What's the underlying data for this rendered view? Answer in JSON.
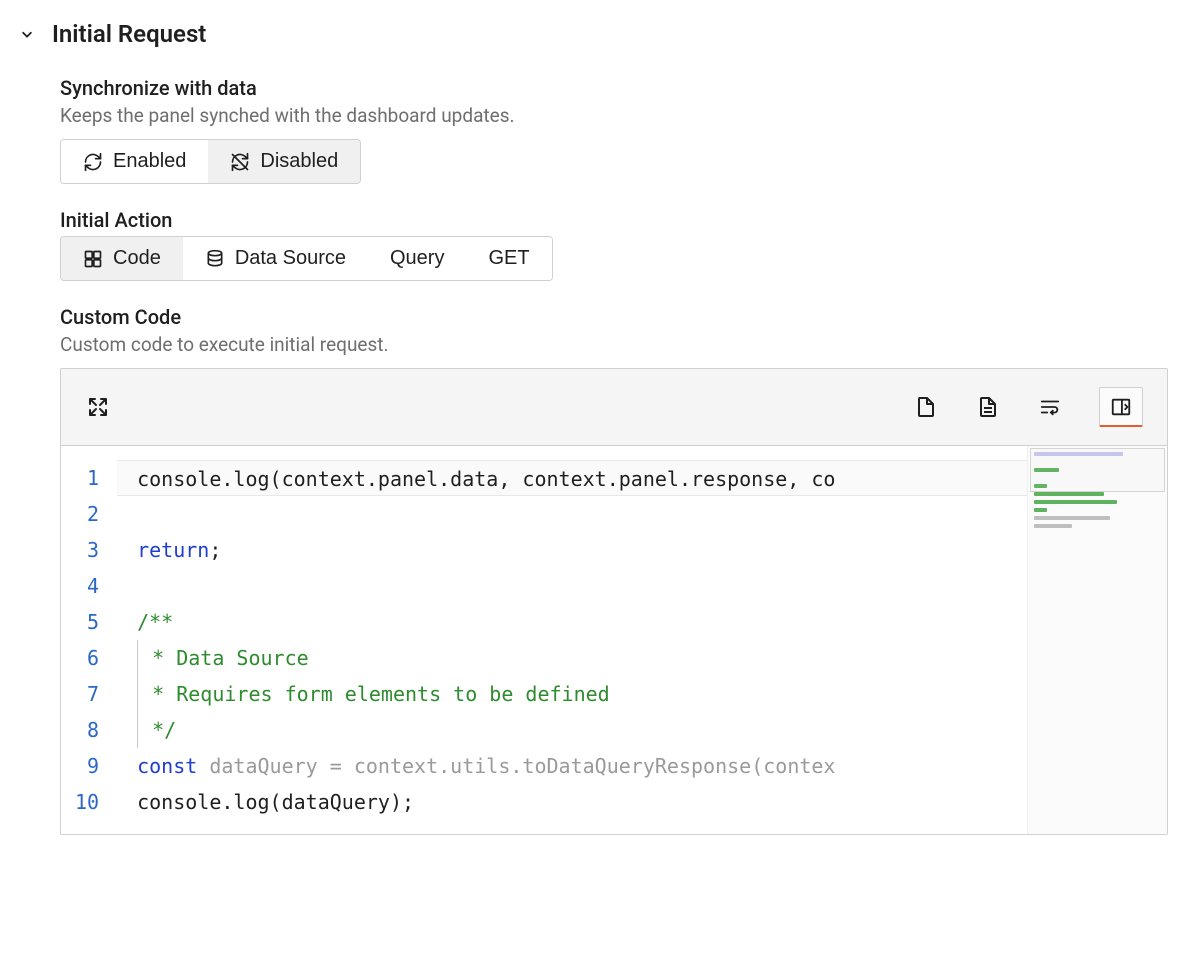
{
  "section": {
    "title": "Initial Request"
  },
  "sync": {
    "label": "Synchronize with data",
    "description": "Keeps the panel synched with the dashboard updates.",
    "options": {
      "enabled": "Enabled",
      "disabled": "Disabled"
    },
    "selected": "disabled"
  },
  "initialAction": {
    "label": "Initial Action",
    "options": {
      "code": "Code",
      "dataSource": "Data Source",
      "query": "Query",
      "get": "GET"
    },
    "selected": "code"
  },
  "customCode": {
    "label": "Custom Code",
    "description": "Custom code to execute initial request.",
    "lines": [
      {
        "n": "1",
        "tokens": [
          [
            "ident",
            "console.log(context.panel.data, context.panel.response, co"
          ]
        ]
      },
      {
        "n": "2",
        "tokens": []
      },
      {
        "n": "3",
        "tokens": [
          [
            "keyword",
            "return"
          ],
          [
            "ident",
            ";"
          ]
        ]
      },
      {
        "n": "4",
        "tokens": []
      },
      {
        "n": "5",
        "tokens": [
          [
            "comment",
            "/**"
          ]
        ]
      },
      {
        "n": "6",
        "tokens": [
          [
            "comment",
            " * Data Source"
          ]
        ]
      },
      {
        "n": "7",
        "tokens": [
          [
            "comment",
            " * Requires form elements to be defined"
          ]
        ]
      },
      {
        "n": "8",
        "tokens": [
          [
            "comment",
            " */"
          ]
        ]
      },
      {
        "n": "9",
        "tokens": [
          [
            "keyword",
            "const "
          ],
          [
            "dim",
            "dataQuery = context.utils.toDataQueryResponse(contex"
          ]
        ]
      },
      {
        "n": "10",
        "tokens": [
          [
            "ident",
            "console.log(dataQuery);"
          ]
        ]
      }
    ]
  }
}
